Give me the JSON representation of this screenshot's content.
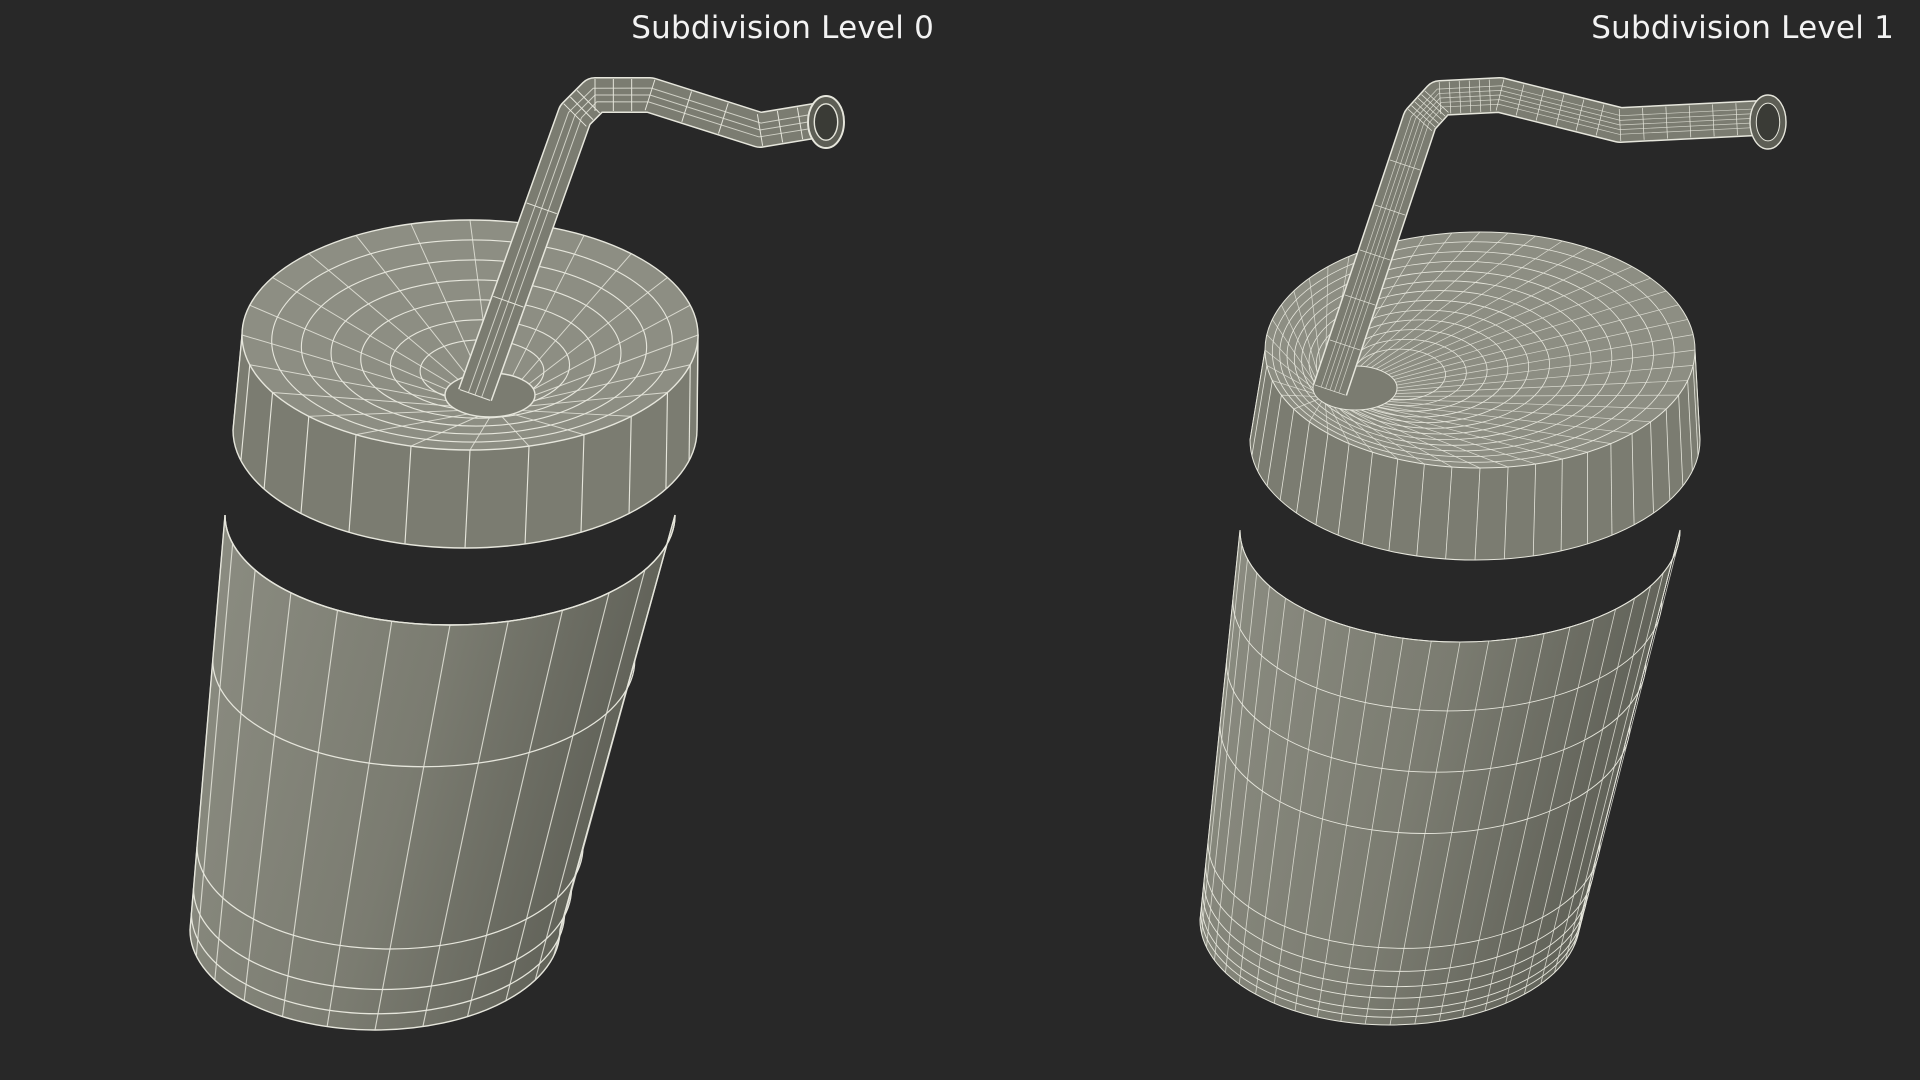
{
  "viewports": [
    {
      "id": "left",
      "label": "Subdivision Level 0",
      "subdivision_level": 0
    },
    {
      "id": "right",
      "label": "Subdivision Level 1",
      "subdivision_level": 1
    }
  ],
  "colors": {
    "background": "#282828",
    "surface": "#7b7c71",
    "surface_shadow": "#5d5e55",
    "surface_highlight": "#8d8e83",
    "wire": "#e6e6dc",
    "label_text": "#f2f2f2"
  },
  "object_name": "cup-with-straw"
}
